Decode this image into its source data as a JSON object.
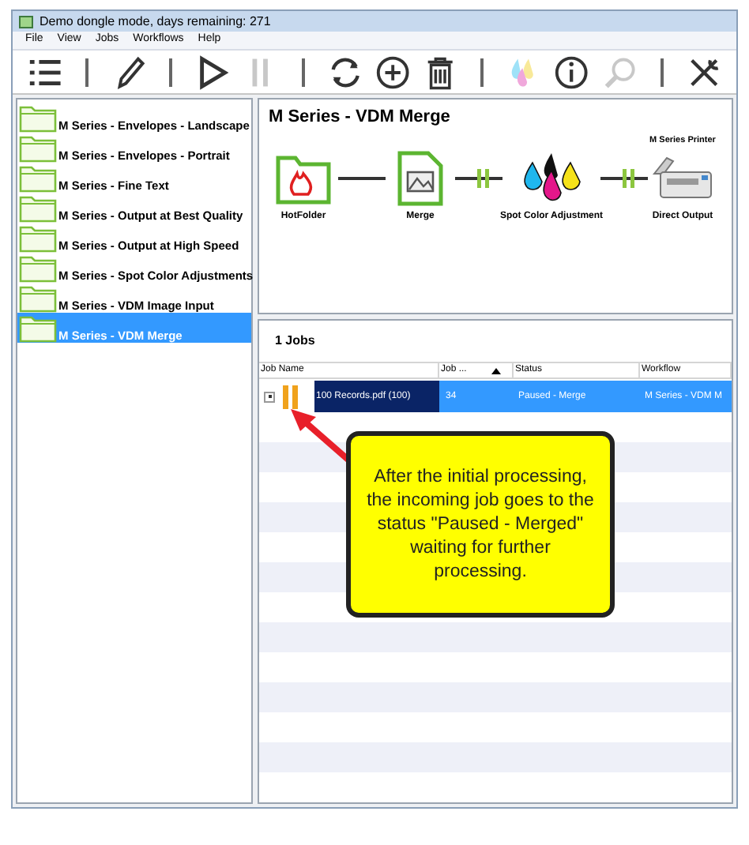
{
  "window": {
    "title": "Demo dongle mode, days remaining: 271"
  },
  "menu": [
    "File",
    "View",
    "Jobs",
    "Workflows",
    "Help"
  ],
  "toolbar": [
    {
      "kind": "list",
      "disabled": false
    },
    {
      "kind": "separator"
    },
    {
      "kind": "edit",
      "disabled": false
    },
    {
      "kind": "separator"
    },
    {
      "kind": "play",
      "disabled": false
    },
    {
      "kind": "pause",
      "disabled": true
    },
    {
      "kind": "separator"
    },
    {
      "kind": "refresh",
      "disabled": false
    },
    {
      "kind": "add",
      "disabled": false
    },
    {
      "kind": "delete",
      "disabled": false
    },
    {
      "kind": "separator"
    },
    {
      "kind": "inks",
      "disabled": true
    },
    {
      "kind": "info",
      "disabled": false
    },
    {
      "kind": "search",
      "disabled": true
    },
    {
      "kind": "separator"
    },
    {
      "kind": "tools",
      "disabled": false
    }
  ],
  "sidebar": {
    "items": [
      {
        "label": "M Series - Envelopes - Landscape",
        "selected": false
      },
      {
        "label": "M Series - Envelopes - Portrait",
        "selected": false
      },
      {
        "label": "M Series - Fine Text",
        "selected": false
      },
      {
        "label": "M Series - Output at Best Quality",
        "selected": false
      },
      {
        "label": "M Series - Output at High Speed",
        "selected": false
      },
      {
        "label": "M Series - Spot Color Adjustments",
        "selected": false
      },
      {
        "label": "M Series - VDM Image Input",
        "selected": false
      },
      {
        "label": "M Series - VDM Merge",
        "selected": true
      }
    ]
  },
  "workflow": {
    "title": "M Series - VDM Merge",
    "printer_name": "M Series Printer",
    "steps": [
      {
        "kind": "hotfolder",
        "label": "HotFolder"
      },
      {
        "kind": "merge",
        "label": "Merge"
      },
      {
        "kind": "inks",
        "label": "Spot Color Adjustment"
      },
      {
        "kind": "printer",
        "label": "Direct Output"
      }
    ],
    "connectors": [
      {
        "gate": false
      },
      {
        "gate": true
      },
      {
        "gate": true
      }
    ]
  },
  "jobs": {
    "count": "1 Jobs",
    "columns": [
      {
        "label": "Job Name",
        "sorted": false
      },
      {
        "label": "Job ...",
        "sorted": true
      },
      {
        "label": "Status",
        "sorted": false
      },
      {
        "label": "Workflow",
        "sorted": false
      }
    ],
    "rows": [
      {
        "name": "100 Records.pdf (100)",
        "number": "34",
        "status": "Paused - Merge",
        "workflow": "M Series - VDM M",
        "paused": true,
        "selected": true
      }
    ]
  },
  "callout": {
    "text": "After the initial processing, the incoming job goes to the status \"Paused - Merged\" waiting for further processing."
  }
}
